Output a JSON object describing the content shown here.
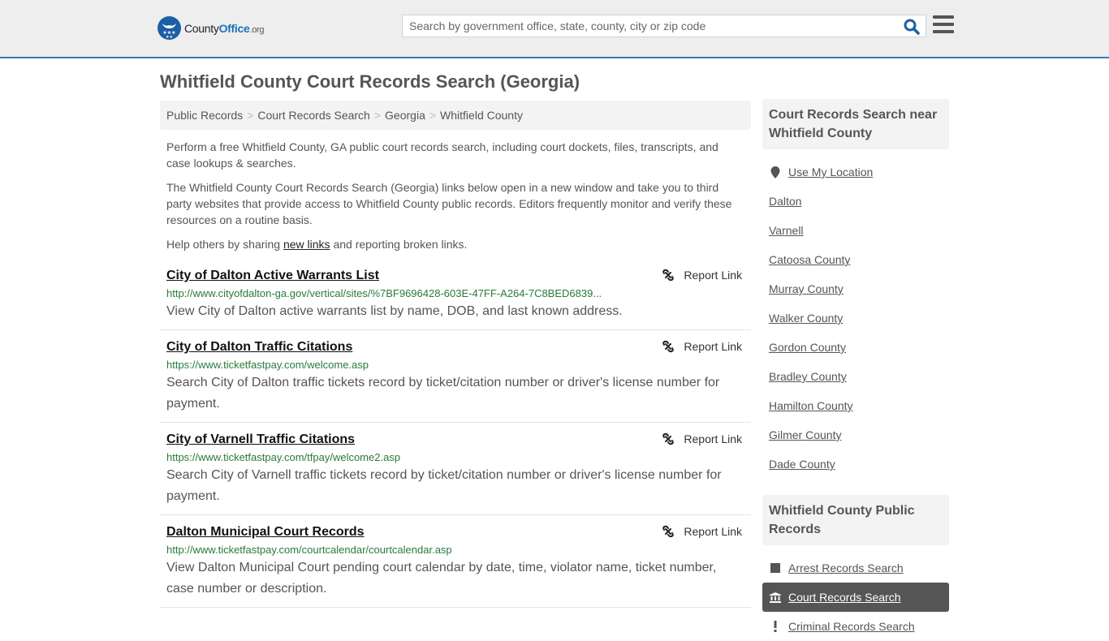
{
  "header": {
    "logo": {
      "brand_prefix": "County",
      "brand_main": "Office",
      "brand_suffix": ".org"
    },
    "search": {
      "placeholder": "Search by government office, state, county, city or zip code",
      "value": ""
    },
    "icons": {
      "search": "search-icon",
      "menu": "hamburger-menu-icon"
    }
  },
  "page": {
    "title": "Whitfield County Court Records Search (Georgia)"
  },
  "breadcrumb": [
    {
      "label": "Public Records"
    },
    {
      "label": "Court Records Search"
    },
    {
      "label": "Georgia"
    },
    {
      "label": "Whitfield County"
    }
  ],
  "breadcrumb_separator": ">",
  "intro": {
    "p1": "Perform a free Whitfield County, GA public court records search, including court dockets, files, transcripts, and case lookups & searches.",
    "p2": "The Whitfield County Court Records Search (Georgia) links below open in a new window and take you to third party websites that provide access to Whitfield County public records. Editors frequently monitor and verify these resources on a routine basis.",
    "p3_before": "Help others by sharing ",
    "p3_link": "new links",
    "p3_after": " and reporting broken links."
  },
  "results": [
    {
      "title": "City of Dalton Active Warrants List",
      "url": "http://www.cityofdalton-ga.gov/vertical/sites/%7BF9696428-603E-47FF-A264-7C8BED6839...",
      "description": "View City of Dalton active warrants list by name, DOB, and last known address.",
      "report_label": "Report Link"
    },
    {
      "title": "City of Dalton Traffic Citations",
      "url": "https://www.ticketfastpay.com/welcome.asp",
      "description": "Search City of Dalton traffic tickets record by ticket/citation number or driver's license number for payment.",
      "report_label": "Report Link"
    },
    {
      "title": "City of Varnell Traffic Citations",
      "url": "https://www.ticketfastpay.com/tfpay/welcome2.asp",
      "description": "Search City of Varnell traffic tickets record by ticket/citation number or driver's license number for payment.",
      "report_label": "Report Link"
    },
    {
      "title": "Dalton Municipal Court Records",
      "url": "http://www.ticketfastpay.com/courtcalendar/courtcalendar.asp",
      "description": "View Dalton Municipal Court pending court calendar by date, time, violator name, ticket number, case number or description.",
      "report_label": "Report Link"
    }
  ],
  "sidebar": {
    "nearby": {
      "heading": "Court Records Search near Whitfield County",
      "use_location": "Use My Location",
      "items": [
        {
          "label": "Dalton"
        },
        {
          "label": "Varnell"
        },
        {
          "label": "Catoosa County"
        },
        {
          "label": "Murray County"
        },
        {
          "label": "Walker County"
        },
        {
          "label": "Gordon County"
        },
        {
          "label": "Bradley County"
        },
        {
          "label": "Hamilton County"
        },
        {
          "label": "Gilmer County"
        },
        {
          "label": "Dade County"
        }
      ]
    },
    "public_records": {
      "heading": "Whitfield County Public Records",
      "items": [
        {
          "label": "Arrest Records Search",
          "icon": "square-icon",
          "active": false
        },
        {
          "label": "Court Records Search",
          "icon": "courthouse-icon",
          "active": true
        },
        {
          "label": "Criminal Records Search",
          "icon": "exclamation-icon",
          "active": false
        }
      ]
    }
  },
  "colors": {
    "header_bg": "#eeeeee",
    "header_border": "#3b7aac",
    "brand_blue": "#1d6fbd",
    "url_green": "#2a7a3a",
    "active_item_bg": "#555555"
  }
}
